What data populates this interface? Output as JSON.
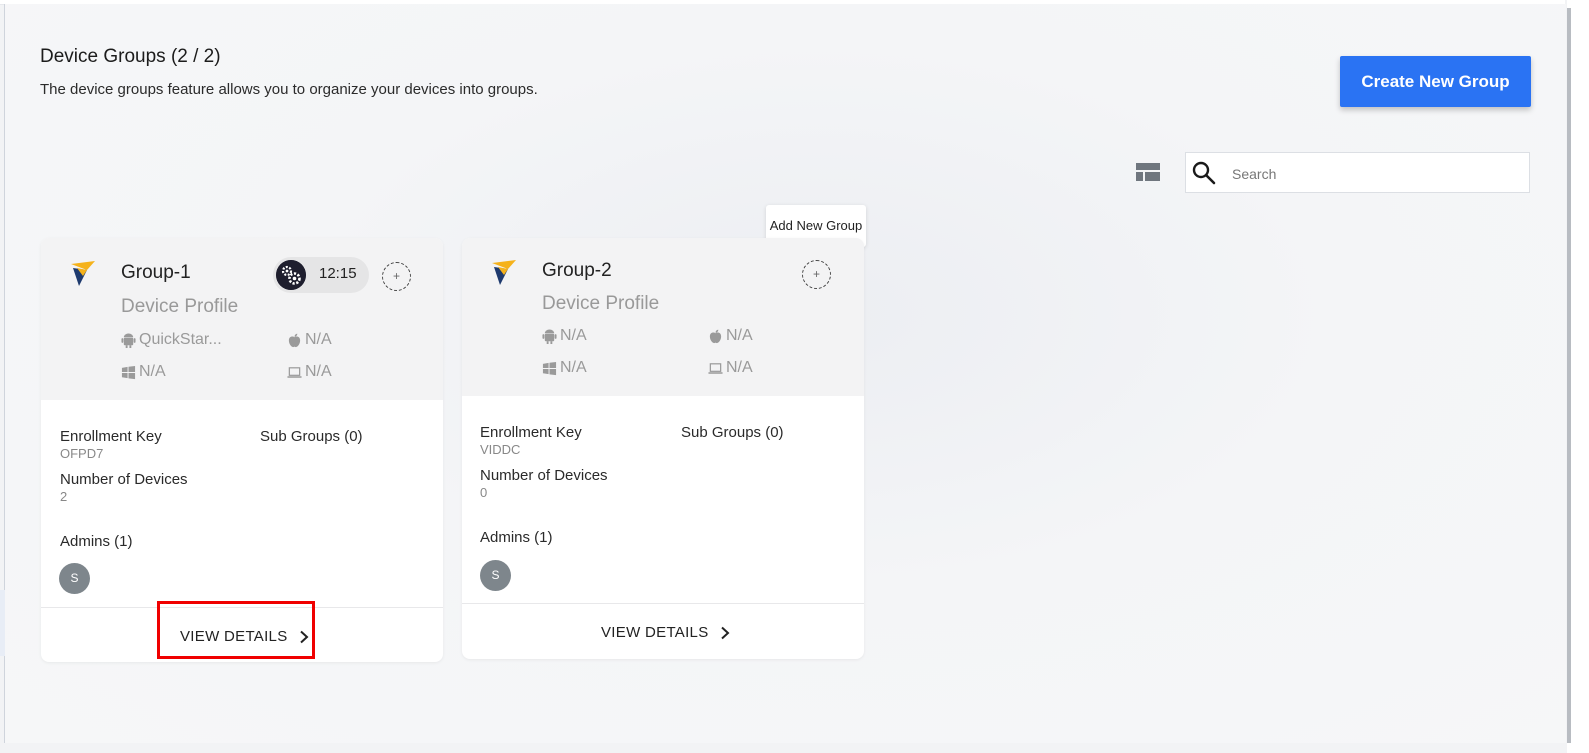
{
  "header": {
    "title": "Device Groups (2 / 2)",
    "subtitle": "The device groups feature allows you to organize your devices into groups.",
    "create_button": "Create New Group"
  },
  "search": {
    "placeholder": "Search"
  },
  "tooltip": "Add New Group",
  "colors": {
    "accent": "#2a73f3",
    "highlight": "#f00000",
    "logo_yellow": "#f5b21b",
    "logo_navy": "#1e3a6e"
  },
  "groups": [
    {
      "name": "Group-1",
      "profile_label": "Device Profile",
      "schedule_time": "12:15",
      "platforms": {
        "android": "QuickStar...",
        "apple": "N/A",
        "windows": "N/A",
        "laptop": "N/A"
      },
      "enrollment_key_label": "Enrollment Key",
      "enrollment_key": "OFPD7",
      "sub_groups": "Sub Groups (0)",
      "devices_label": "Number of Devices",
      "devices": "2",
      "admins": "Admins (1)",
      "admin_initial": "S",
      "view_details": "VIEW DETAILS"
    },
    {
      "name": "Group-2",
      "profile_label": "Device Profile",
      "platforms": {
        "android": "N/A",
        "apple": "N/A",
        "windows": "N/A",
        "laptop": "N/A"
      },
      "enrollment_key_label": "Enrollment Key",
      "enrollment_key": "VIDDC",
      "sub_groups": "Sub Groups (0)",
      "devices_label": "Number of Devices",
      "devices": "0",
      "admins": "Admins (1)",
      "admin_initial": "S",
      "view_details": "VIEW DETAILS"
    }
  ],
  "add_symbol": "+"
}
